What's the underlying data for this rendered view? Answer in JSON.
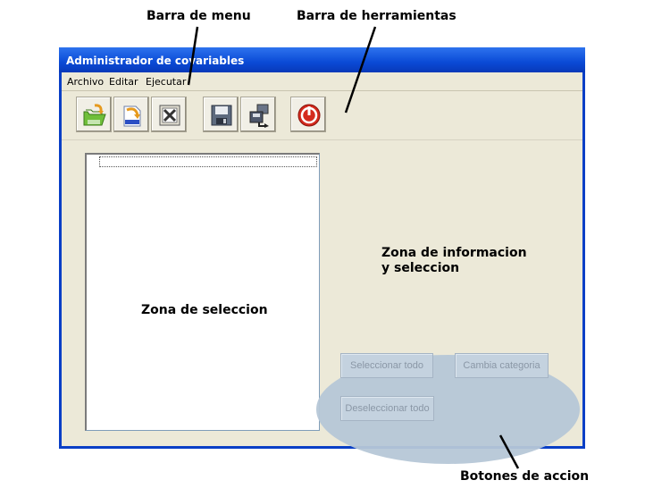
{
  "annotations": {
    "menu_bar": "Barra de menu",
    "toolbar": "Barra de herramientas",
    "action_buttons": "Botones de accion",
    "selection_zone": "Zona de seleccion",
    "info_zone_line1": "Zona de informacion",
    "info_zone_line2": "y seleccion"
  },
  "window": {
    "title": "Administrador de covariables"
  },
  "menu": {
    "items": [
      "Archivo",
      "Editar",
      "Ejecutar"
    ]
  },
  "toolbar": {
    "buttons": [
      "open-ascii-icon",
      "import-ascii-icon",
      "delete-icon",
      "save-icon",
      "export-icon",
      "power-icon"
    ]
  },
  "actions": {
    "select_all": "Seleccionar todo",
    "change_category": "Cambia categoria",
    "deselect_all": "Deseleccionar todo"
  },
  "colors": {
    "titlebar": "#0a4ad6",
    "client_bg": "#ece9d8",
    "highlight_ellipse": "#b6c7d7",
    "power_red": "#d42a1e"
  }
}
